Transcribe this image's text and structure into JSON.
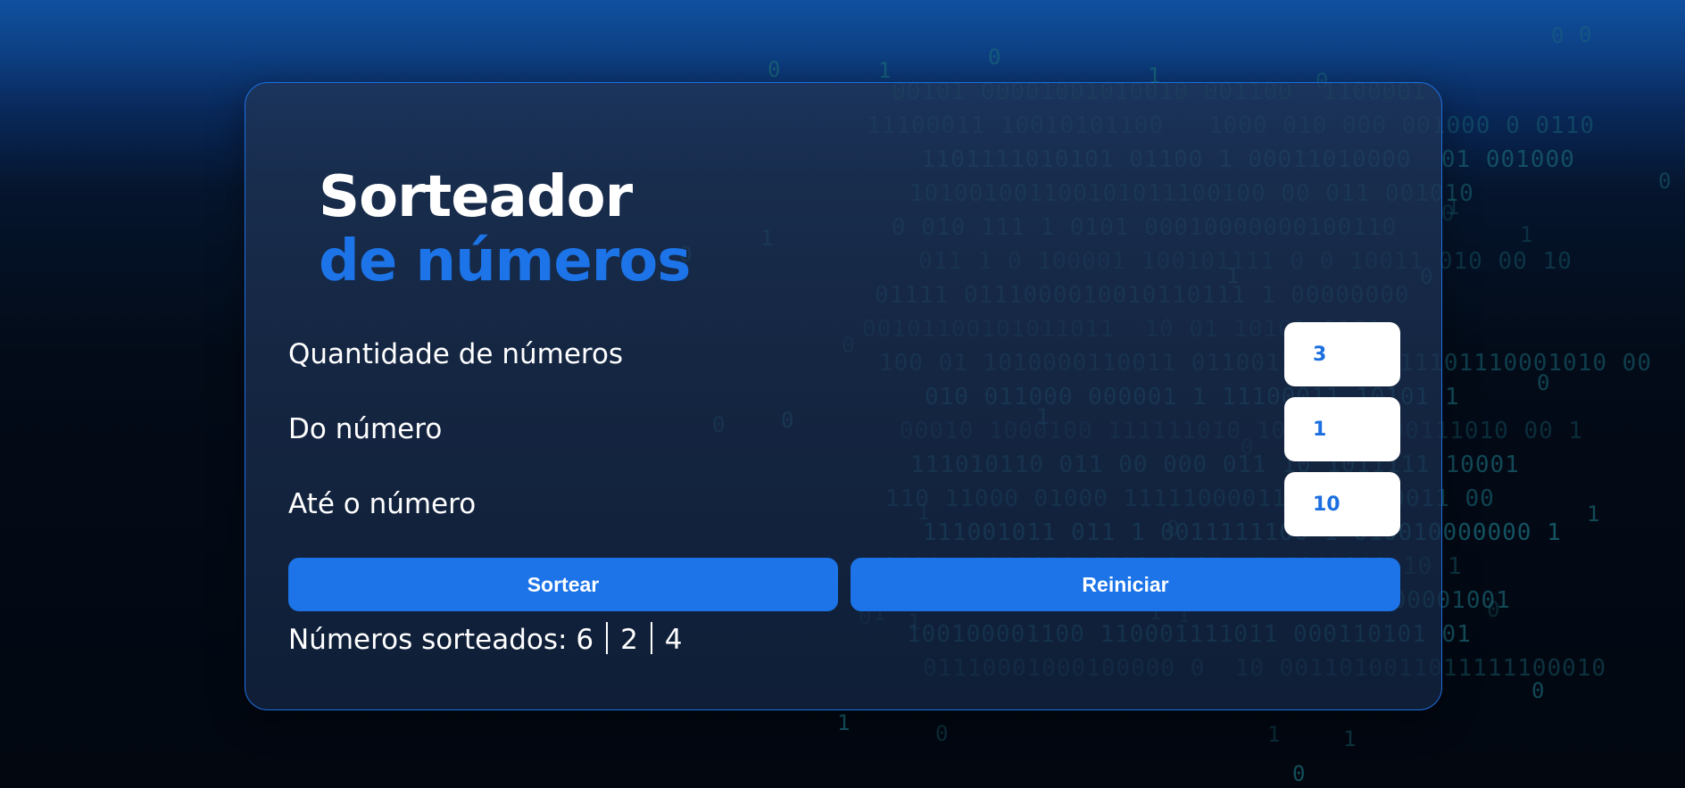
{
  "page": {
    "title_line_1": "Sorteador",
    "title_line_2": "de números"
  },
  "form": {
    "quantity": {
      "label": "Quantidade de números",
      "value": "3"
    },
    "from": {
      "label": "Do número",
      "value": "1"
    },
    "to": {
      "label": "Até o número",
      "value": "10"
    }
  },
  "buttons": {
    "draw_label": "Sortear",
    "reset_label": "Reiniciar"
  },
  "result": {
    "label": "Números sorteados:",
    "numbers": [
      "6",
      "2",
      "4"
    ]
  },
  "colors": {
    "accent": "#1c74e8",
    "card_border": "#1f6fe0",
    "binary_digits": "#1a6a78"
  }
}
